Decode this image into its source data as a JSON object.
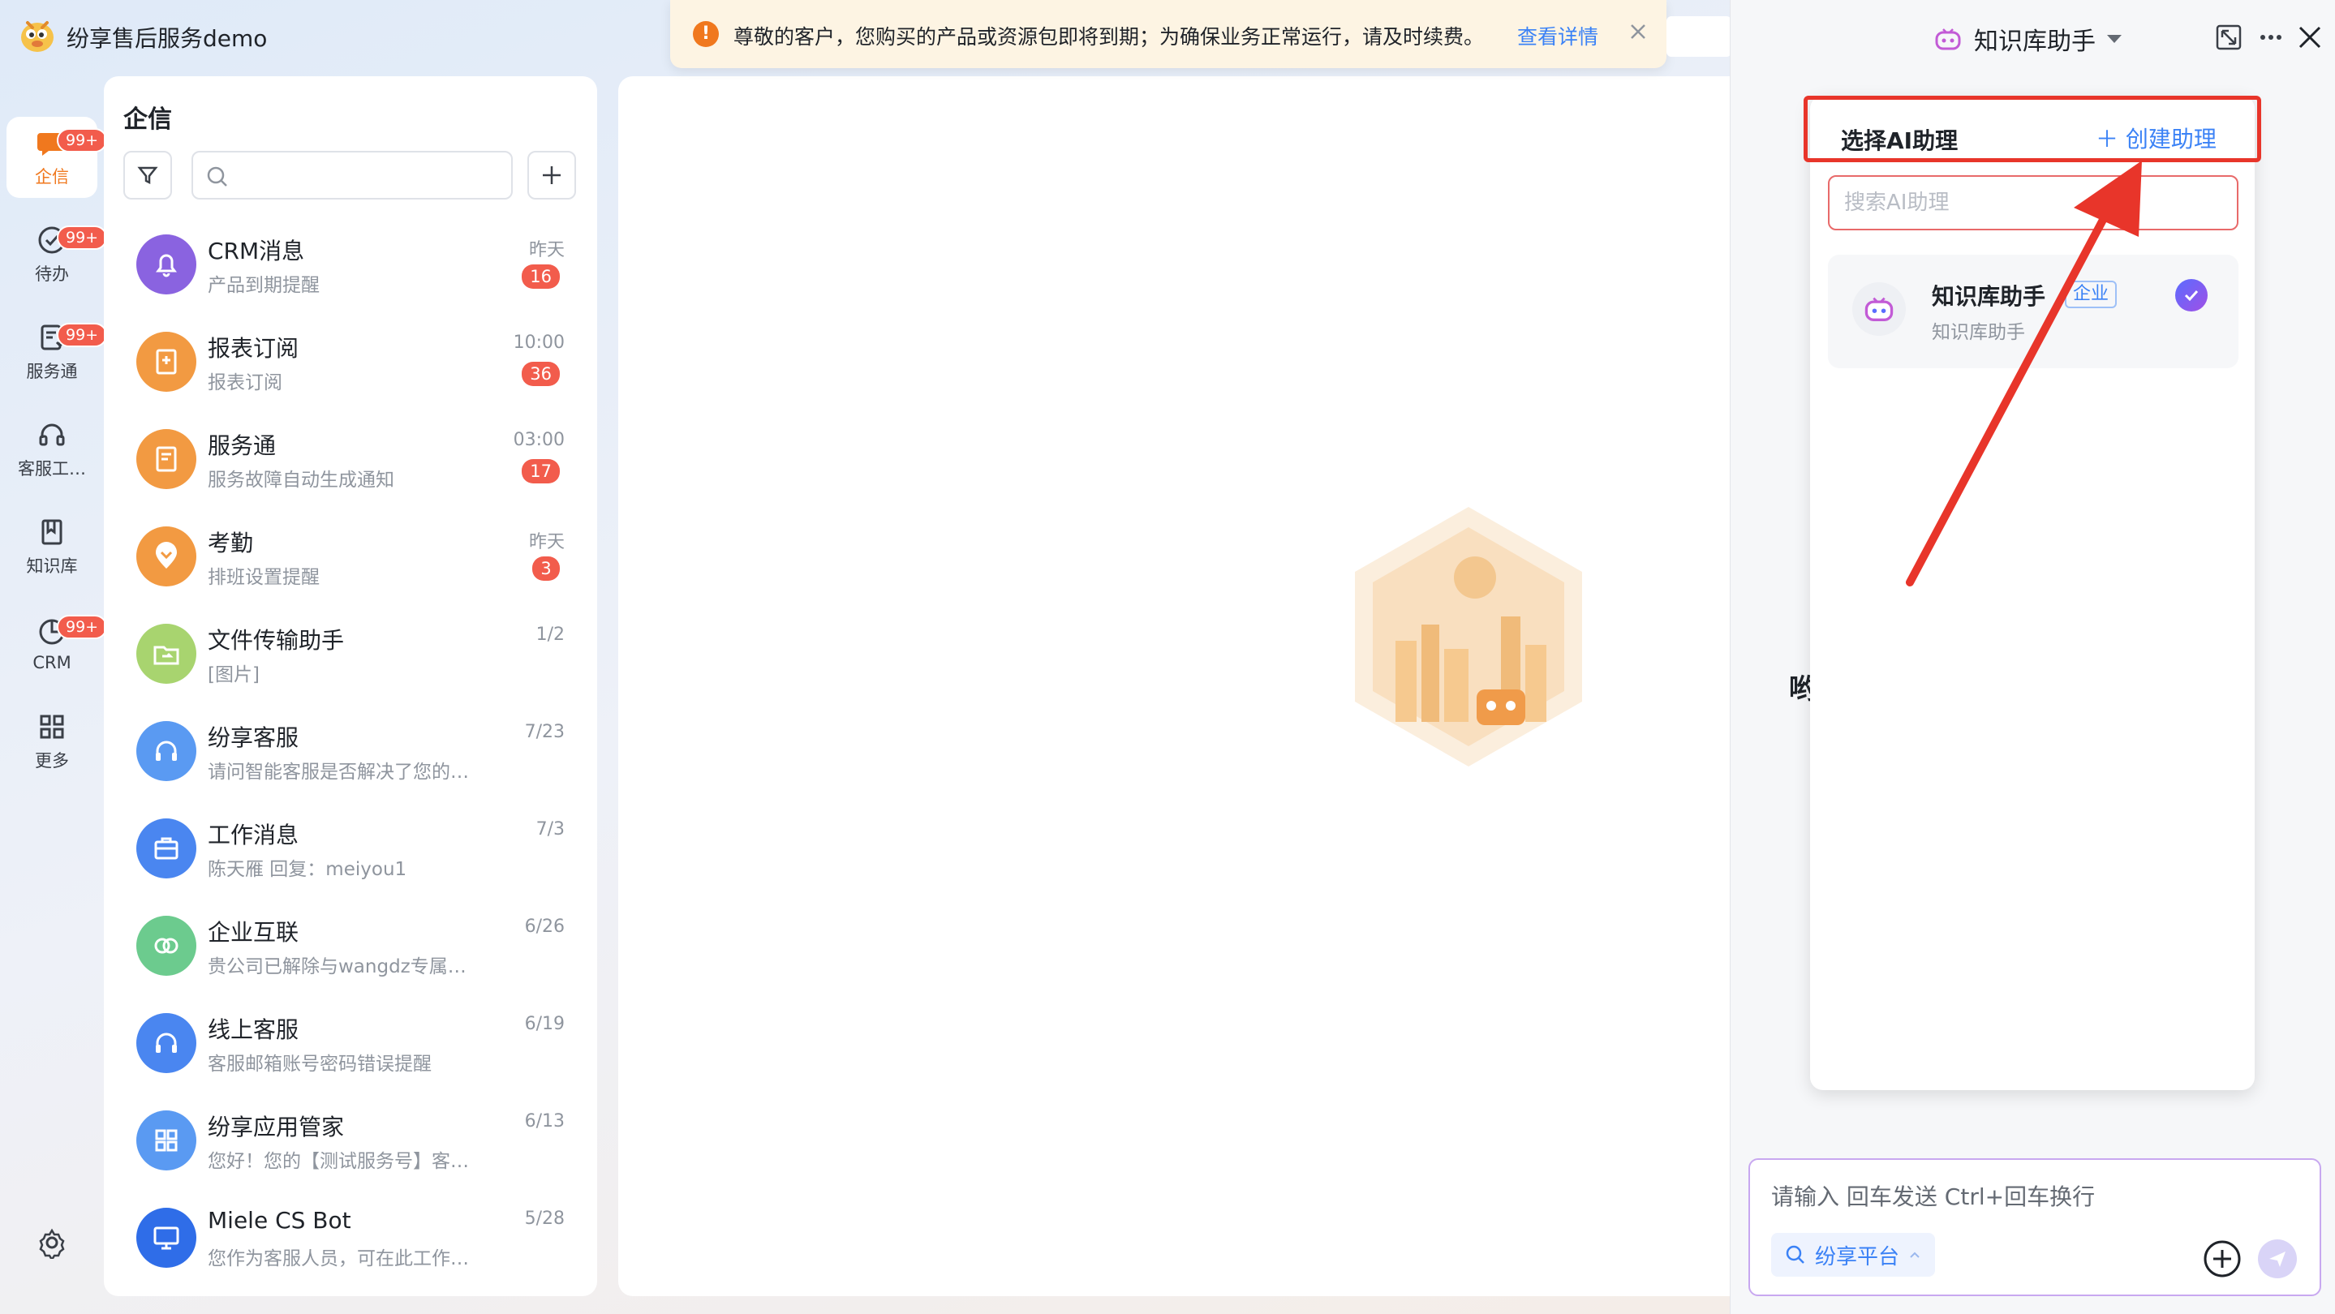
{
  "app": {
    "title": "纷享售后服务demo"
  },
  "rail": [
    {
      "key": "qixin",
      "label": "企信",
      "badge": "99+",
      "active": true
    },
    {
      "key": "todo",
      "label": "待办",
      "badge": "99+"
    },
    {
      "key": "service",
      "label": "服务通",
      "badge": "99+"
    },
    {
      "key": "cs",
      "label": "客服工…",
      "badge": ""
    },
    {
      "key": "kb",
      "label": "知识库",
      "badge": ""
    },
    {
      "key": "crm",
      "label": "CRM",
      "badge": "99+"
    },
    {
      "key": "more",
      "label": "更多",
      "badge": ""
    }
  ],
  "list": {
    "title": "企信",
    "search_placeholder": "",
    "conversations": [
      {
        "name": "CRM消息",
        "preview": "产品到期提醒",
        "time": "昨天",
        "count": "16",
        "color": "#8a63e0",
        "icon": "bell-icon"
      },
      {
        "name": "报表订阅",
        "preview": "报表订阅",
        "time": "10:00",
        "count": "36",
        "color": "#f29a42",
        "icon": "report-icon"
      },
      {
        "name": "服务通",
        "preview": "服务故障自动生成通知",
        "time": "03:00",
        "count": "17",
        "color": "#f29a42",
        "icon": "service-icon"
      },
      {
        "name": "考勤",
        "preview": "排班设置提醒",
        "time": "昨天",
        "count": "3",
        "color": "#f29a42",
        "icon": "location-heart-icon"
      },
      {
        "name": "文件传输助手",
        "preview": "[图片]",
        "time": "1/2",
        "count": "",
        "color": "#a8d46f",
        "icon": "folder-transfer-icon"
      },
      {
        "name": "纷享客服",
        "preview": "请问智能客服是否解决了您的…",
        "time": "7/23",
        "count": "",
        "color": "#5a9af2",
        "icon": "headset-icon"
      },
      {
        "name": "工作消息",
        "preview": "陈天雁 回复：meiyou1",
        "time": "7/3",
        "count": "",
        "color": "#4a86f0",
        "icon": "briefcase-icon"
      },
      {
        "name": "企业互联",
        "preview": "贵公司已解除与wangdz专属…",
        "time": "6/26",
        "count": "",
        "color": "#6ccb8e",
        "icon": "link-circles-icon"
      },
      {
        "name": "线上客服",
        "preview": "客服邮箱账号密码错误提醒",
        "time": "6/19",
        "count": "",
        "color": "#4a86f0",
        "icon": "headset-icon"
      },
      {
        "name": "纷享应用管家",
        "preview": "您好！您的【测试服务号】客…",
        "time": "6/13",
        "count": "",
        "color": "#5a9af2",
        "icon": "apps-grid-icon"
      },
      {
        "name": "Miele CS Bot",
        "preview": "您作为客服人员，可在此工作…",
        "time": "5/28",
        "count": "",
        "color": "#2f6de8",
        "icon": "monitor-icon"
      }
    ]
  },
  "notice": {
    "text": "尊敬的客户，您购买的产品或资源包即将到期；为确保业务正常运行，请及时续费。",
    "link": "查看详情"
  },
  "assistant": {
    "header_label": "知识库助手",
    "dropdown_title": "选择AI助理",
    "create_label": "创建助理",
    "search_placeholder": "搜索AI助理",
    "item": {
      "name": "知识库助手",
      "tag": "企业",
      "desc": "知识库助手"
    },
    "side_fragment": "哟",
    "input_placeholder": "请输入 回车发送 Ctrl+回车换行",
    "platform_label": "纷享平台"
  },
  "colors": {
    "accent": "#3b82f6",
    "badge": "#f25c4c",
    "highlight": "#e8352a",
    "active_rail": "#f0781e"
  }
}
